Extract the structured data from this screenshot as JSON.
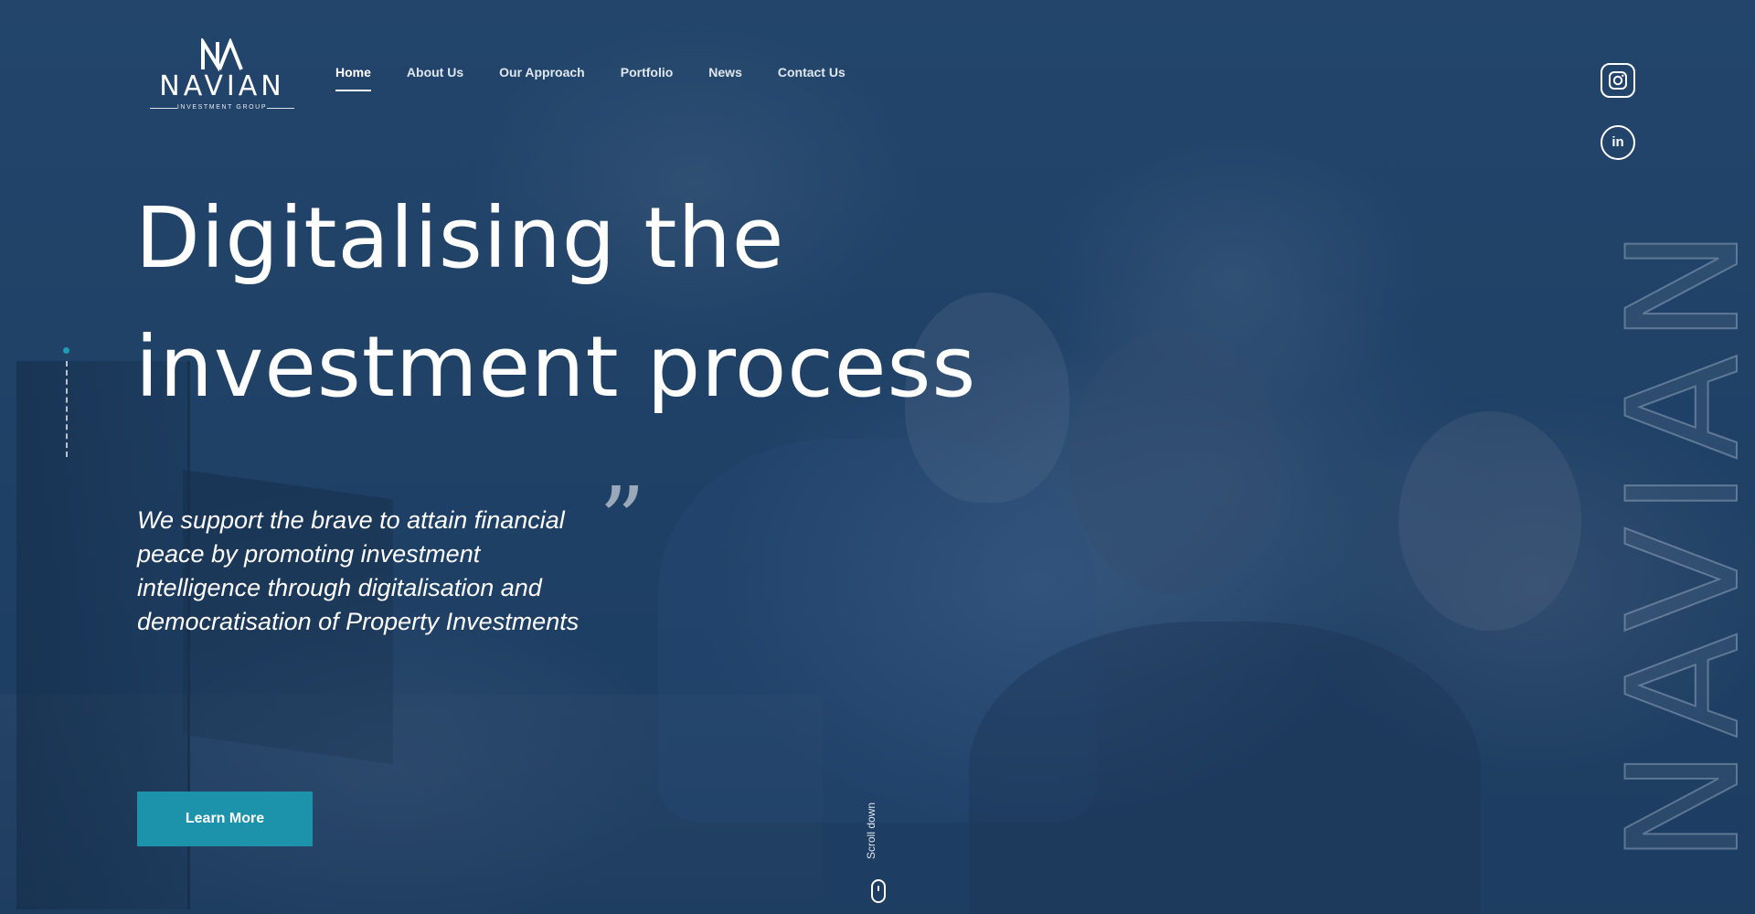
{
  "brand": {
    "name": "NAVIAN",
    "subtitle": "INVESTMENT GROUP",
    "watermark": "NAVIAN"
  },
  "nav": {
    "items": [
      {
        "label": "Home",
        "active": true
      },
      {
        "label": "About Us",
        "active": false
      },
      {
        "label": "Our Approach",
        "active": false
      },
      {
        "label": "Portfolio",
        "active": false
      },
      {
        "label": "News",
        "active": false
      },
      {
        "label": "Contact Us",
        "active": false
      }
    ]
  },
  "social": {
    "instagram_icon": "instagram-icon",
    "linkedin_label": "in"
  },
  "hero": {
    "headline_line1": "Digitalising the",
    "headline_line2": "investment process",
    "quote_mark": "”",
    "tagline": "We support the brave to attain financial peace by promoting investment intelligence through digitalisation and democratisation of Property Investments",
    "cta_label": "Learn More",
    "scroll_label": "Scroll down"
  },
  "colors": {
    "accent": "#1d93ab",
    "overlay": "#1c3e64",
    "text": "#ffffff"
  }
}
